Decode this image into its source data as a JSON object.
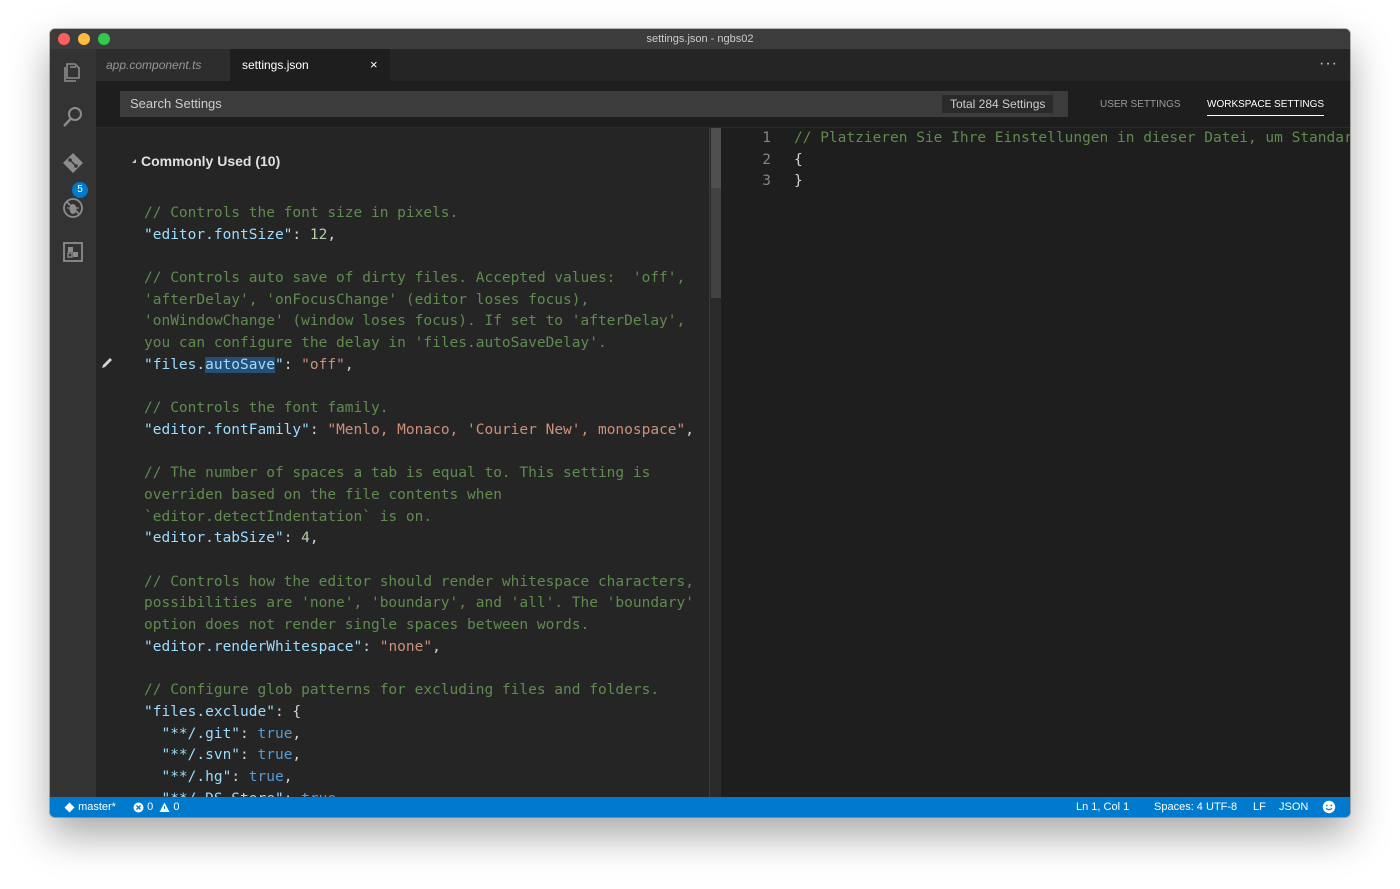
{
  "window": {
    "title": "settings.json - ngbs02"
  },
  "activity_bar": {
    "scm_badge": "5"
  },
  "tabs": [
    {
      "label": "app.component.ts"
    },
    {
      "label": "settings.json",
      "close_glyph": "×"
    }
  ],
  "more_actions": "···",
  "search": {
    "placeholder": "Search Settings",
    "count": "Total 284 Settings"
  },
  "scopes": {
    "user": "USER SETTINGS",
    "workspace": "WORKSPACE SETTINGS"
  },
  "default_settings": {
    "section_title": "Commonly Used (10)",
    "lines": [
      {
        "type": "comment",
        "text": "// Controls the font size in pixels."
      },
      {
        "type": "kv",
        "key": "\"editor.fontSize\"",
        "sep": ": ",
        "value": "12",
        "value_type": "number",
        "tail": ","
      },
      {
        "type": "blank",
        "text": ""
      },
      {
        "type": "comment",
        "text": "// Controls auto save of dirty files. Accepted values:  'off',"
      },
      {
        "type": "comment",
        "text": "'afterDelay', 'onFocusChange' (editor loses focus),"
      },
      {
        "type": "comment",
        "text": "'onWindowChange' (window loses focus). If set to 'afterDelay',"
      },
      {
        "type": "comment",
        "text": "you can configure the delay in 'files.autoSaveDelay'."
      },
      {
        "type": "kv_hl",
        "key_pre": "\"files.",
        "key_hl": "autoSave",
        "key_post": "\"",
        "sep": ": ",
        "value": "\"off\"",
        "value_type": "string",
        "tail": ","
      },
      {
        "type": "blank",
        "text": ""
      },
      {
        "type": "comment",
        "text": "// Controls the font family."
      },
      {
        "type": "kv",
        "key": "\"editor.fontFamily\"",
        "sep": ": ",
        "value": "\"Menlo, Monaco, 'Courier New', monospace\"",
        "value_type": "string",
        "tail": ","
      },
      {
        "type": "blank",
        "text": ""
      },
      {
        "type": "comment",
        "text": "// The number of spaces a tab is equal to. This setting is"
      },
      {
        "type": "comment",
        "text": "overriden based on the file contents when"
      },
      {
        "type": "comment",
        "text": "`editor.detectIndentation` is on."
      },
      {
        "type": "kv",
        "key": "\"editor.tabSize\"",
        "sep": ": ",
        "value": "4",
        "value_type": "number",
        "tail": ","
      },
      {
        "type": "blank",
        "text": ""
      },
      {
        "type": "comment",
        "text": "// Controls how the editor should render whitespace characters,"
      },
      {
        "type": "comment",
        "text": "possibilities are 'none', 'boundary', and 'all'. The 'boundary'"
      },
      {
        "type": "comment",
        "text": "option does not render single spaces between words."
      },
      {
        "type": "kv",
        "key": "\"editor.renderWhitespace\"",
        "sep": ": ",
        "value": "\"none\"",
        "value_type": "string",
        "tail": ","
      },
      {
        "type": "blank",
        "text": ""
      },
      {
        "type": "comment",
        "text": "// Configure glob patterns for excluding files and folders."
      },
      {
        "type": "kv",
        "key": "\"files.exclude\"",
        "sep": ": ",
        "value": "{",
        "value_type": "plain",
        "tail": ""
      },
      {
        "type": "kv",
        "key": "  \"**/.git\"",
        "sep": ": ",
        "value": "true",
        "value_type": "bool",
        "tail": ","
      },
      {
        "type": "kv",
        "key": "  \"**/.svn\"",
        "sep": ": ",
        "value": "true",
        "value_type": "bool",
        "tail": ","
      },
      {
        "type": "kv",
        "key": "  \"**/.hg\"",
        "sep": ": ",
        "value": "true",
        "value_type": "bool",
        "tail": ","
      },
      {
        "type": "kv",
        "key": "  \"**/.DS_Store\"",
        "sep": ": ",
        "value": "true",
        "value_type": "bool",
        "tail": ","
      }
    ]
  },
  "workspace_editor": {
    "line_numbers": [
      "1",
      "2",
      "3"
    ],
    "lines": [
      {
        "type": "comment",
        "text": "// Platzieren Sie Ihre Einstellungen in dieser Datei, um Standar"
      },
      {
        "type": "plain",
        "text": "{"
      },
      {
        "type": "plain",
        "text": "}"
      }
    ]
  },
  "status_bar": {
    "branch": "master*",
    "errors": "0",
    "warnings": "0",
    "position": "Ln 1, Col 1",
    "indent": "Spaces: 4",
    "encoding": "UTF-8",
    "eol": "LF",
    "language": "JSON"
  },
  "colors": {
    "status_bar": "#007acc",
    "comment": "#608b4e",
    "key": "#9cdcfe",
    "string": "#ce9178",
    "number": "#b5cea8",
    "boolean": "#569cd6"
  }
}
